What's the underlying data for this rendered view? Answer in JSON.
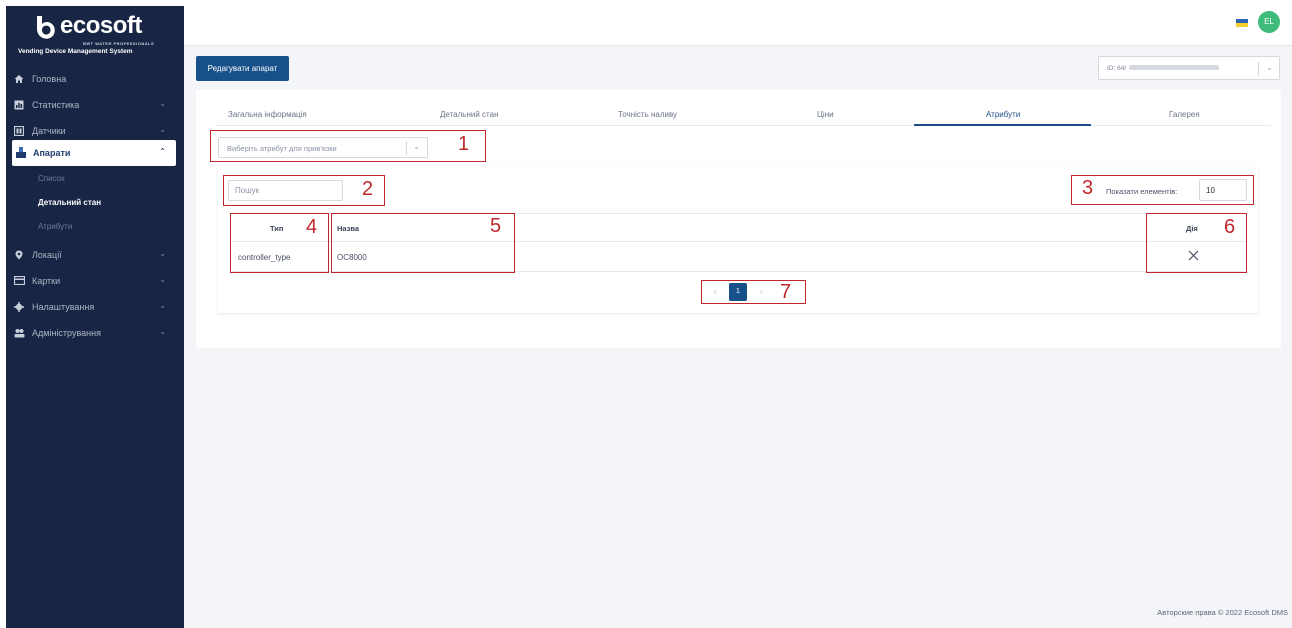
{
  "brand": {
    "logo_text": "ecosoft",
    "logo_sub": "BWT WATER PROFESSIONALS",
    "system_name": "Vending Device Management System"
  },
  "sidebar": {
    "items": [
      {
        "label": "Головна",
        "icon": "home-icon"
      },
      {
        "label": "Статистика",
        "icon": "stats-icon"
      },
      {
        "label": "Датчики",
        "icon": "sensor-icon"
      },
      {
        "label": "Апарати",
        "icon": "machine-icon",
        "active": true
      },
      {
        "label": "Локації",
        "icon": "location-icon"
      },
      {
        "label": "Картки",
        "icon": "card-icon"
      },
      {
        "label": "Налаштування",
        "icon": "gear-icon"
      },
      {
        "label": "Адміністрування",
        "icon": "users-icon"
      }
    ],
    "subitems": [
      "Список",
      "Детальний стан",
      "Атрибути"
    ]
  },
  "header": {
    "avatar_initials": "EL",
    "flag_colors": [
      "#2f64b2",
      "#f4cf2d"
    ]
  },
  "toolbar": {
    "edit_button": "Редагувати апарат",
    "device_select_prefix": "ID: 64/"
  },
  "tabs": [
    "Загальна інформація",
    "Детальний стан",
    "Точність наливу",
    "Ціни",
    "Атрибути",
    "Галерея"
  ],
  "active_tab": "Атрибути",
  "attribute_select": {
    "placeholder": "Виберіть атрибут для прив'язки"
  },
  "table_controls": {
    "search_placeholder": "Пошук",
    "show_label": "Показати елементів:",
    "show_value": "10"
  },
  "table": {
    "columns": [
      "Тип",
      "Назва",
      "Дія"
    ],
    "rows": [
      {
        "type": "controller_type",
        "name": "OC8000",
        "action": "delete-icon"
      }
    ]
  },
  "pagination": {
    "current_page": "1"
  },
  "annotations": [
    "1",
    "2",
    "3",
    "4",
    "5",
    "6",
    "7"
  ],
  "footer": {
    "copyright": "Авторские права © 2022 Ecosoft DMS"
  },
  "colors": {
    "sidebar_bg": "#192544",
    "primary": "#18518a",
    "annotation_red": "#c0282d",
    "avatar_green": "#3fbb7b"
  }
}
